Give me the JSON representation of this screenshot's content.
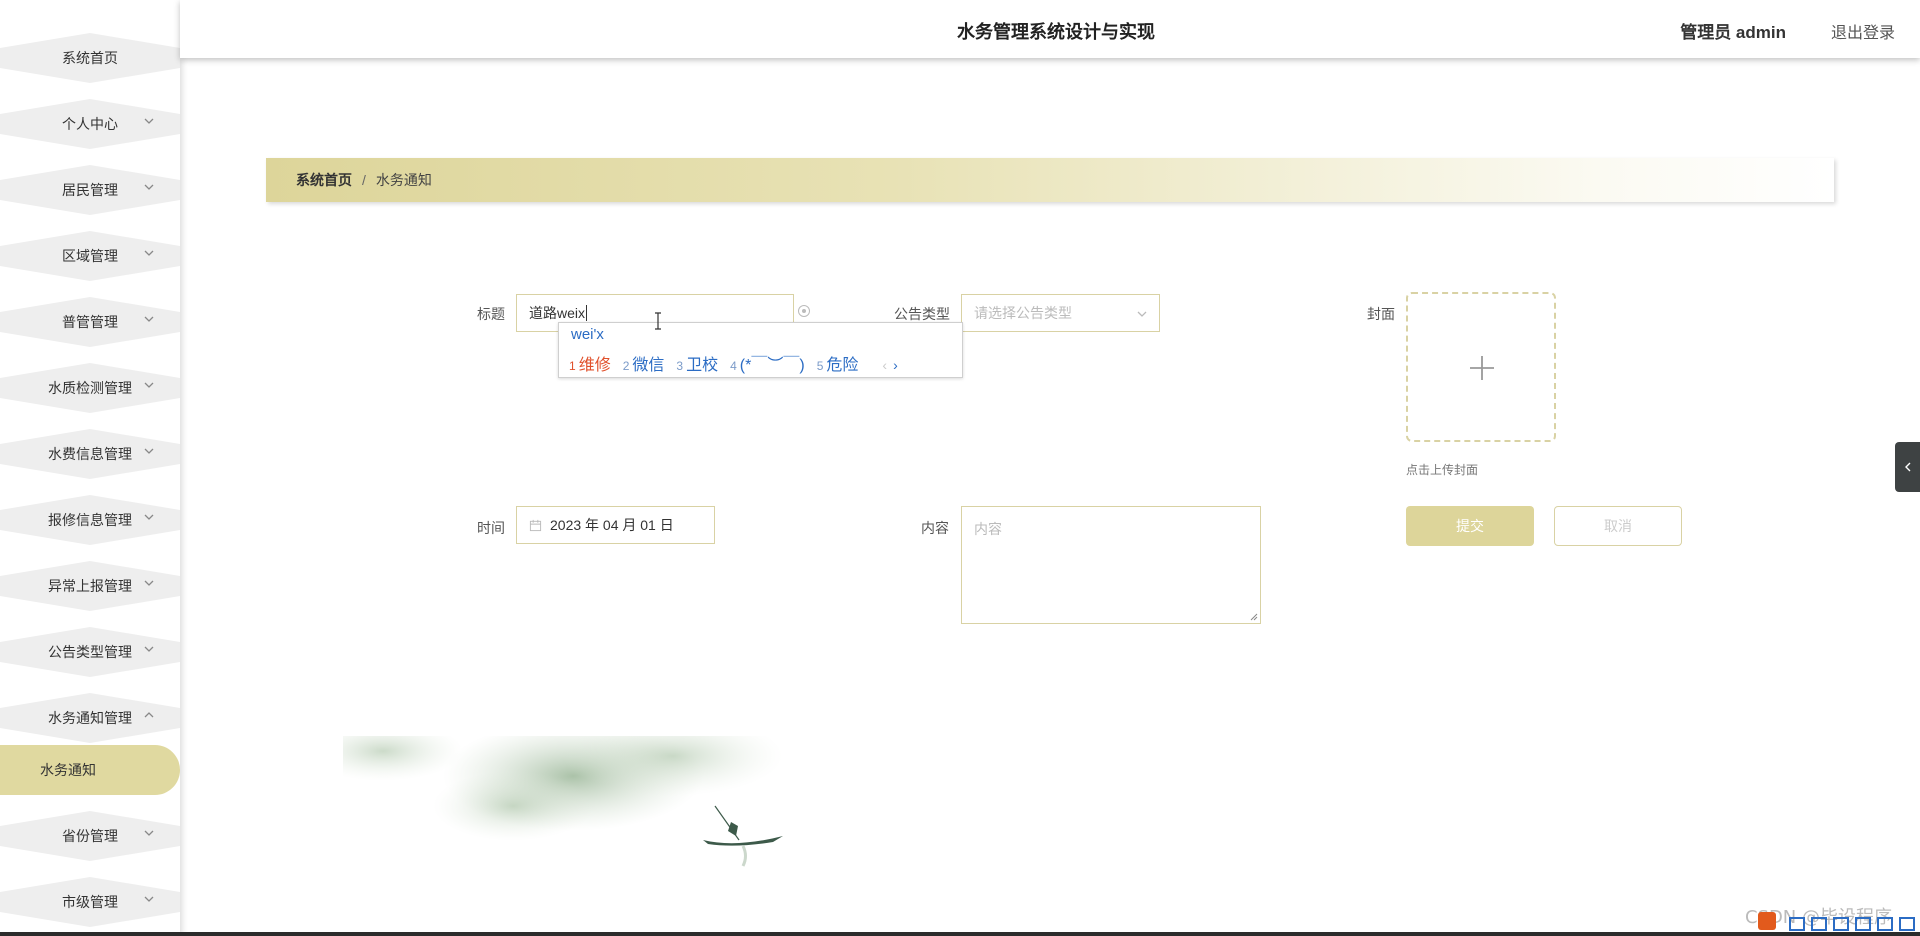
{
  "header": {
    "title": "水务管理系统设计与实现",
    "user": "管理员 admin",
    "logout": "退出登录"
  },
  "sidebar": {
    "items": [
      {
        "label": "系统首页",
        "has_chevron": false,
        "expanded": false
      },
      {
        "label": "个人中心",
        "has_chevron": true,
        "expanded": false
      },
      {
        "label": "居民管理",
        "has_chevron": true,
        "expanded": false
      },
      {
        "label": "区域管理",
        "has_chevron": true,
        "expanded": false
      },
      {
        "label": "普管管理",
        "has_chevron": true,
        "expanded": false
      },
      {
        "label": "水质检测管理",
        "has_chevron": true,
        "expanded": false
      },
      {
        "label": "水费信息管理",
        "has_chevron": true,
        "expanded": false
      },
      {
        "label": "报修信息管理",
        "has_chevron": true,
        "expanded": false
      },
      {
        "label": "异常上报管理",
        "has_chevron": true,
        "expanded": false
      },
      {
        "label": "公告类型管理",
        "has_chevron": true,
        "expanded": false
      },
      {
        "label": "水务通知管理",
        "has_chevron": true,
        "expanded": true
      },
      {
        "label": "省份管理",
        "has_chevron": true,
        "expanded": false
      },
      {
        "label": "市级管理",
        "has_chevron": true,
        "expanded": false
      }
    ],
    "active_subitem": "水务通知"
  },
  "breadcrumb": {
    "home": "系统首页",
    "separator": "/",
    "current": "水务通知"
  },
  "form": {
    "title_label": "标题",
    "title_value": "道路weix",
    "type_label": "公告类型",
    "type_placeholder": "请选择公告类型",
    "cover_label": "封面",
    "cover_hint": "点击上传封面",
    "time_label": "时间",
    "time_value": "2023 年 04 月 01 日",
    "content_label": "内容",
    "content_placeholder": "内容",
    "submit_label": "提交",
    "cancel_label": "取消"
  },
  "ime": {
    "composition": "wei'x",
    "candidates": [
      {
        "num": "1",
        "text": "维修"
      },
      {
        "num": "2",
        "text": "微信"
      },
      {
        "num": "3",
        "text": "卫校"
      },
      {
        "num": "4",
        "text": "(*￣︶￣)"
      },
      {
        "num": "5",
        "text": "危险"
      }
    ],
    "prev": "‹",
    "next": "›"
  },
  "watermark": "CSDN @毕设程序",
  "colors": {
    "accent": "#ddd59a",
    "active_item_bg": "#e0d9a0",
    "border": "#d9d2a4",
    "ime_blue": "#2b6cc4",
    "ime_highlight": "#e0502b"
  }
}
